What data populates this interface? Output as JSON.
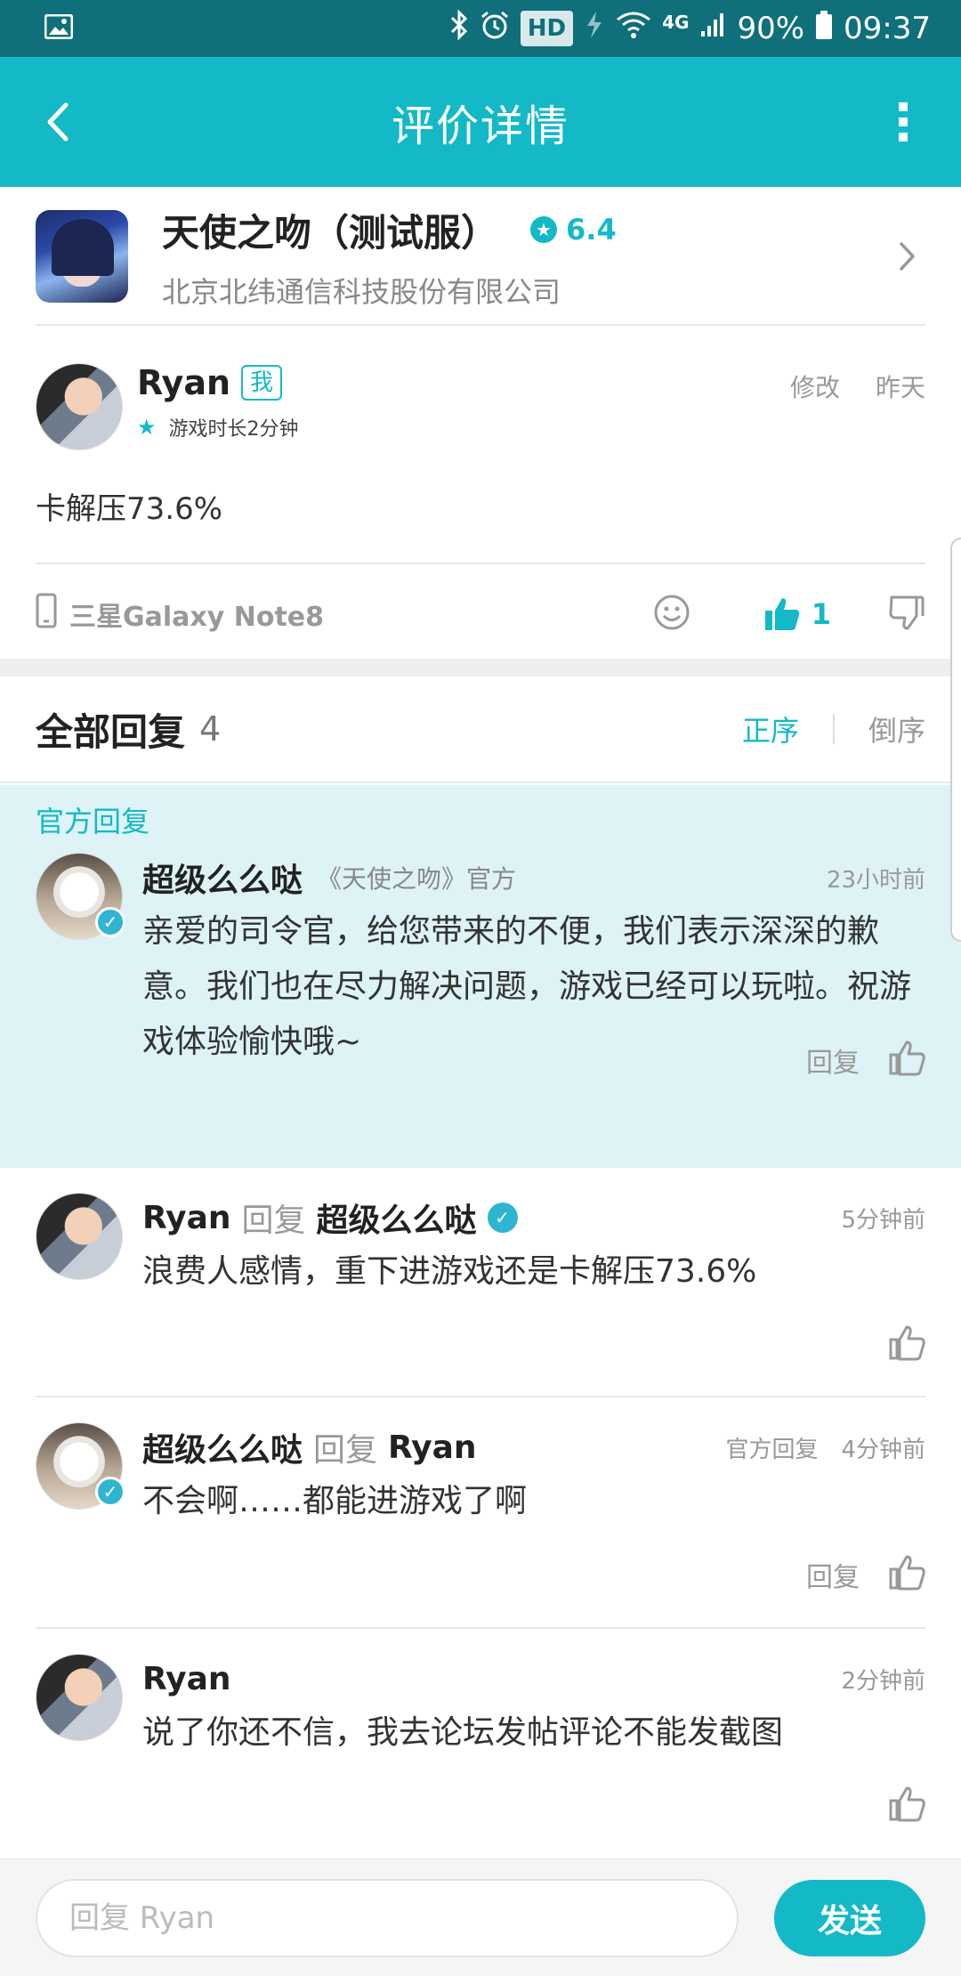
{
  "status_bar": {
    "hd": "HD",
    "network": "4G",
    "battery": "90%",
    "time": "09:37"
  },
  "app_bar": {
    "title": "评价详情"
  },
  "game": {
    "name": "天使之吻（测试服）",
    "rating": "6.4",
    "company": "北京北纬通信科技股份有限公司"
  },
  "review": {
    "user": "Ryan",
    "me_badge": "我",
    "playtime": "游戏时长2分钟",
    "edit": "修改",
    "date": "昨天",
    "content": "卡解压73.6%",
    "device": "三星Galaxy Note8",
    "like_count": "1"
  },
  "replies_header": {
    "label": "全部回复",
    "count": "4",
    "sort_asc": "正序",
    "sort_desc": "倒序"
  },
  "official_reply": {
    "tag": "官方回复",
    "name": "超级么么哒",
    "subtitle": "《天使之吻》官方",
    "time": "23小时前",
    "text": "亲爱的司令官，给您带来的不便，我们表示深深的歉意。我们也在尽力解决问题，游戏已经可以玩啦。祝游戏体验愉快哦~",
    "reply_label": "回复"
  },
  "replies": [
    {
      "name": "Ryan",
      "reply_word": "回复",
      "target": "超级么么哒",
      "time": "5分钟前",
      "text": "浪费人感情，重下进游戏还是卡解压73.6%"
    },
    {
      "name": "超级么么哒",
      "reply_word": "回复",
      "target": "Ryan",
      "official_tag": "官方回复",
      "time": "4分钟前",
      "text": "不会啊……都能进游戏了啊",
      "reply_label": "回复"
    },
    {
      "name": "Ryan",
      "time": "2分钟前",
      "text": "说了你还不信，我去论坛发帖评论不能发截图"
    }
  ],
  "input": {
    "placeholder": "回复 Ryan",
    "send": "发送"
  },
  "colors": {
    "accent": "#14b9c8",
    "status_bar": "#0f6f7b",
    "official_bg": "#ddf3f6"
  }
}
